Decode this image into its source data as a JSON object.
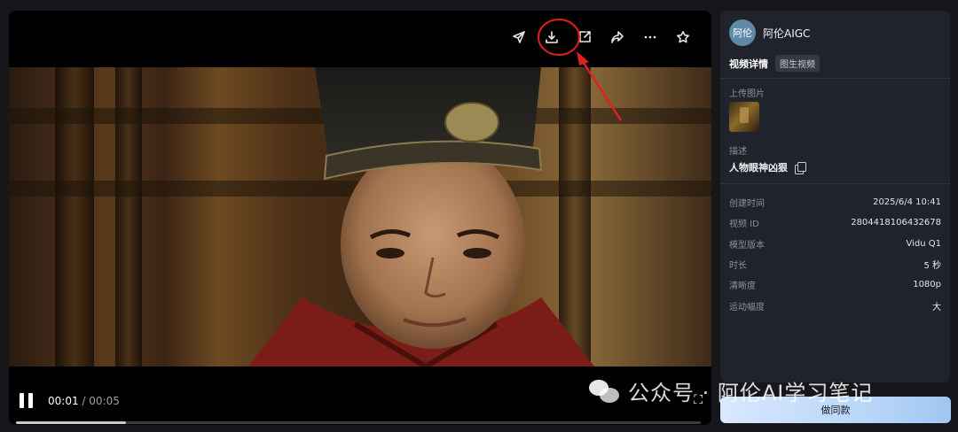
{
  "player": {
    "current_time": "00:01",
    "separator": "/",
    "total_time": "00:05",
    "progress": 0.16,
    "toolbar_icons": [
      "send-icon",
      "download-icon",
      "edit-icon",
      "share-icon",
      "more-icon",
      "star-icon"
    ]
  },
  "detail": {
    "user": {
      "avatar_text": "阿伦",
      "name": "阿伦AIGC"
    },
    "tab_active": "视频详情",
    "tab_tag": "图生视频",
    "upload_label": "上传图片",
    "desc_label": "描述",
    "desc_text": "人物眼神凶狠",
    "meta": [
      {
        "key": "创建时间",
        "value": "2025/6/4 10:41"
      },
      {
        "key": "视频 ID",
        "value": "2804418106432678"
      },
      {
        "key": "模型版本",
        "value": "Vidu Q1"
      },
      {
        "key": "时长",
        "value": "5 秒"
      },
      {
        "key": "清晰度",
        "value": "1080p"
      },
      {
        "key": "运动幅度",
        "value": "大"
      }
    ]
  },
  "make_same_label": "做同款",
  "watermark": {
    "text": "公众号 · 阿伦AI学习笔记"
  },
  "colors": {
    "annotation": "#e02020",
    "button_gradient_start": "#d9e8ff",
    "button_gradient_end": "#9fc6f2"
  }
}
